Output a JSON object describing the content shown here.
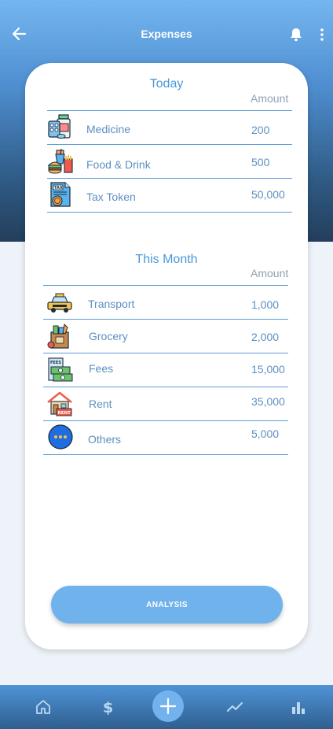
{
  "header": {
    "title": "Expenses",
    "icons": {
      "back": "arrow-left-icon",
      "notifications": "bell-icon",
      "menu": "more-vertical-icon"
    }
  },
  "today": {
    "title": "Today",
    "amount_header": "Amount",
    "items": [
      {
        "label": "Medicine",
        "amount": "200",
        "icon": "medicine-icon"
      },
      {
        "label": "Food & Drink",
        "amount": "500",
        "icon": "food-drink-icon"
      },
      {
        "label": "Tax Token",
        "amount": "50,000",
        "icon": "tax-token-icon"
      }
    ]
  },
  "month": {
    "title": "This Month",
    "amount_header": "Amount",
    "items": [
      {
        "label": "Transport",
        "amount": "1,000",
        "icon": "taxi-icon"
      },
      {
        "label": "Grocery",
        "amount": "2,000",
        "icon": "grocery-bag-icon"
      },
      {
        "label": "Fees",
        "amount": "15,000",
        "icon": "fees-icon"
      },
      {
        "label": "Rent",
        "amount": "35,000",
        "icon": "rent-house-icon"
      },
      {
        "label": "Others",
        "amount": "5,000",
        "icon": "others-dots-icon"
      }
    ]
  },
  "actions": {
    "analysis_label": "ANALYSIS"
  },
  "bottom_nav": {
    "items": [
      "home-icon",
      "dollar-icon",
      "add-icon",
      "trend-icon",
      "bar-chart-icon"
    ]
  },
  "colors": {
    "accent": "#4a98da",
    "text_blue": "#5d8fc2",
    "button": "#6fb2ec",
    "header_gradient_top": "#74b6f0",
    "header_gradient_bottom": "#233e5b"
  }
}
